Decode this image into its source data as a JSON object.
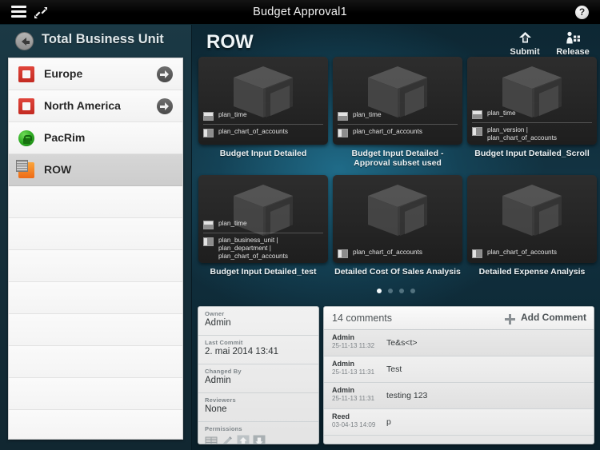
{
  "topbar": {
    "title": "Budget Approval1",
    "menu_icon": "hamburger-icon",
    "expand_icon": "expand-collapse-icon",
    "help_label": "?"
  },
  "sidebar": {
    "title": "Total Business Unit",
    "back_icon": "back-arrow-icon",
    "items": [
      {
        "label": "Europe",
        "icon": "red-square-icon",
        "has_arrow": true,
        "selected": false
      },
      {
        "label": "North America",
        "icon": "red-square-icon",
        "has_arrow": true,
        "selected": false
      },
      {
        "label": "PacRim",
        "icon": "green-lock-icon",
        "has_arrow": false,
        "selected": false
      },
      {
        "label": "ROW",
        "icon": "orange-grid-icon",
        "has_arrow": false,
        "selected": true
      }
    ],
    "empty_rows": 8
  },
  "main": {
    "title": "ROW",
    "actions": [
      {
        "label": "Submit",
        "icon": "submit-up-arrow-icon"
      },
      {
        "label": "Release",
        "icon": "release-person-icon"
      }
    ],
    "cards": [
      {
        "caption": "Budget Input Detailed",
        "badges": [
          "plan_time",
          "plan_chart_of_accounts"
        ],
        "icon": "cube-icon"
      },
      {
        "caption": "Budget Input Detailed - Approval subset used",
        "badges": [
          "plan_time",
          "plan_chart_of_accounts"
        ],
        "icon": "cube-icon"
      },
      {
        "caption": "Budget Input Detailed_Scroll",
        "badges": [
          "plan_time",
          "plan_version | plan_chart_of_accounts"
        ],
        "icon": "cube-icon"
      },
      {
        "caption": "Budget Input Detailed_test",
        "badges": [
          "plan_time",
          "plan_business_unit | plan_department | plan_chart_of_accounts"
        ],
        "icon": "cube-icon"
      },
      {
        "caption": "Detailed Cost Of Sales Analysis",
        "badges": [
          "plan_chart_of_accounts"
        ],
        "icon": "cube-icon"
      },
      {
        "caption": "Detailed Expense Analysis",
        "badges": [
          "plan_chart_of_accounts"
        ],
        "icon": "cube-icon"
      }
    ],
    "pager": {
      "count": 4,
      "active": 0
    }
  },
  "info_panel": {
    "rows": [
      {
        "key": "Owner",
        "value": "Admin"
      },
      {
        "key": "Last Commit",
        "value": "2. mai 2014 13:41"
      },
      {
        "key": "Changed By",
        "value": "Admin"
      },
      {
        "key": "Reviewers",
        "value": "None"
      }
    ],
    "permissions_label": "Permissions",
    "permission_icons": [
      "grid-icon",
      "pencil-icon",
      "submit-up-arrow-icon",
      "release-down-arrow-icon"
    ]
  },
  "comments": {
    "count_label": "14 comments",
    "add_label": "Add Comment",
    "add_icon": "plus-icon",
    "items": [
      {
        "user": "Admin",
        "date": "25-11-13 11:32",
        "text": "Te&s<t>"
      },
      {
        "user": "Admin",
        "date": "25-11-13 11:31",
        "text": "Test"
      },
      {
        "user": "Admin",
        "date": "25-11-13 11:31",
        "text": "testing 123"
      },
      {
        "user": "Reed",
        "date": "03-04-13 14:09",
        "text": "p"
      }
    ]
  },
  "colors": {
    "accent_teal": "#206e8c",
    "panel_dark": "#262626",
    "sidebar_bg": "#16303b",
    "red": "#c32a21",
    "green": "#2aa61f",
    "orange": "#ee6a16"
  }
}
